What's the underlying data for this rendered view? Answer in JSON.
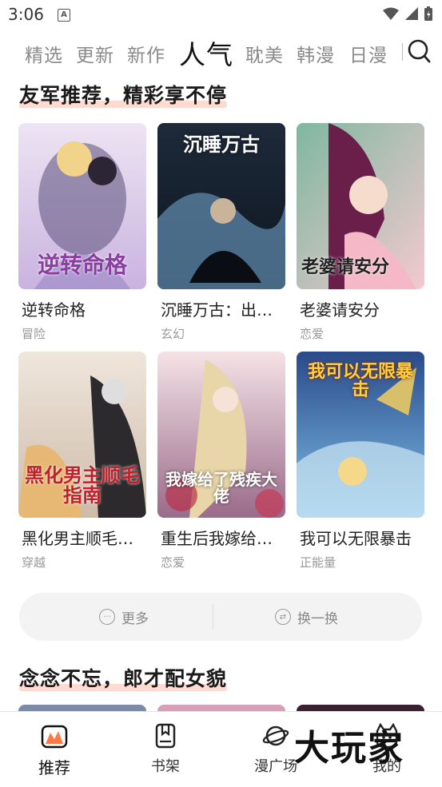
{
  "status_bar": {
    "time": "3:06",
    "notif_letter": "A"
  },
  "tabs": [
    "精选",
    "更新",
    "新作",
    "人气",
    "耽美",
    "韩漫",
    "日漫"
  ],
  "active_tab": "人气",
  "section1": {
    "title": "友军推荐，精彩享不停",
    "cards": [
      {
        "title": "逆转命格",
        "genre": "冒险",
        "cover_text": "逆转命格"
      },
      {
        "title": "沉睡万古：出世就是无敌",
        "genre": "玄幻",
        "cover_text": "沉睡万古"
      },
      {
        "title": "老婆请安分",
        "genre": "恋爱",
        "cover_text": "老婆请安分"
      },
      {
        "title": "黑化男主顺毛指南",
        "genre": "穿越",
        "cover_text": "黑化男主顺毛指南"
      },
      {
        "title": "重生后我嫁给了残疾大佬",
        "genre": "恋爱",
        "cover_text": "我嫁给了残疾大佬"
      },
      {
        "title": "我可以无限暴击",
        "genre": "正能量",
        "cover_text": "我可以无限暴击"
      }
    ]
  },
  "actions": {
    "more_label": "更多",
    "swap_label": "换一换"
  },
  "section2": {
    "title": "念念不忘，郎才配女貌"
  },
  "bottom_nav": [
    {
      "label": "推荐",
      "icon": "recommend-icon",
      "active": true
    },
    {
      "label": "书架",
      "icon": "bookshelf-icon",
      "active": false
    },
    {
      "label": "漫广场",
      "icon": "planet-icon",
      "active": false
    },
    {
      "label": "我的",
      "icon": "profile-icon",
      "active": false
    }
  ],
  "watermark": "大玩家",
  "colors": {
    "accent_underline": "#ff9678",
    "bar_bg": "#f3f3f3"
  }
}
